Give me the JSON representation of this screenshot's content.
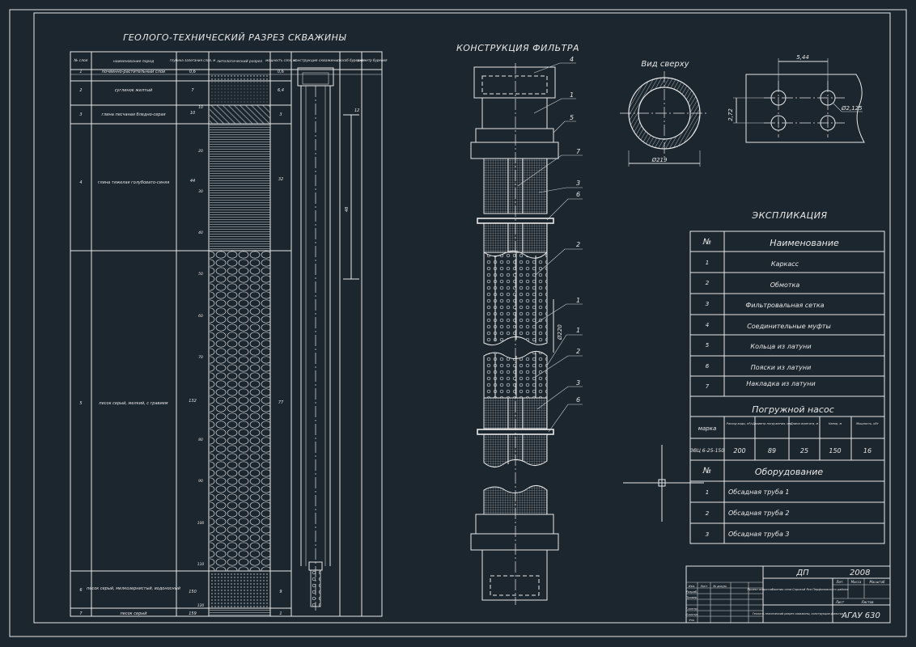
{
  "titles": {
    "section": "ГЕОЛОГО-ТЕХНИЧЕСКИЙ РАЗРЕЗ СКВАЖИНЫ",
    "filter": "КОНСТРУКЦИЯ ФИЛЬТРА",
    "top_view": "Вид сверху",
    "explication": "ЭКСПЛИКАЦИЯ"
  },
  "section_headers": [
    "№ слоя",
    "наименование пород",
    "глубина залегания слоя, м",
    "литологический разрез",
    "мощность слоя, м",
    "конструкция скважины",
    "способ бурения",
    "диаметр бурения"
  ],
  "section_layers": [
    {
      "no": "1",
      "name": "почвенно-растительный слой",
      "depth": "0,6",
      "thick": "0,6"
    },
    {
      "no": "2",
      "name": "суглинок желтый",
      "depth": "7",
      "thick": "6,4"
    },
    {
      "no": "3",
      "name": "глина песчаная бледно-серая",
      "depth": "10",
      "thick": "3"
    },
    {
      "no": "4",
      "name": "глина тяжелая голубовато-синяя",
      "depth": "44",
      "thick": "32"
    },
    {
      "no": "5",
      "name": "песок серый, мелкий, с гравием",
      "depth": "132",
      "thick": "77"
    },
    {
      "no": "6",
      "name": "песок серый, мелкозернистый, водоносный",
      "depth": "150",
      "thick": "9"
    },
    {
      "no": "7",
      "name": "песок серый",
      "depth": "159",
      "thick": "1"
    }
  ],
  "section_depth_ticks": [
    "10",
    "20",
    "30",
    "40",
    "50",
    "60",
    "70",
    "80",
    "90",
    "100",
    "110",
    "120"
  ],
  "section_right": {
    "top": "12",
    "mid": "48"
  },
  "filter_callouts": [
    "4",
    "1",
    "5",
    "7",
    "3",
    "6",
    "2",
    "1",
    "1",
    "2",
    "3",
    "6"
  ],
  "filter_dim": "Ø220",
  "top_view_dims": {
    "outer": "Ø219",
    "pitch_x": "5,44",
    "pitch_y": "2,72",
    "hole": "Ø2,125"
  },
  "explication": {
    "col_no": "№",
    "col_name": "Наименование",
    "rows": [
      {
        "no": "1",
        "name": "Каркасс"
      },
      {
        "no": "2",
        "name": "Обмотка"
      },
      {
        "no": "3",
        "name": "Фильтровальная сетка"
      },
      {
        "no": "4",
        "name": "Соединительные муфты"
      },
      {
        "no": "5",
        "name": "Кольца из латуни"
      },
      {
        "no": "6",
        "name": "Пояски из латуни"
      },
      {
        "no": "7",
        "name": "Накладка из латуни"
      }
    ]
  },
  "pump": {
    "title": "Погружной насос",
    "headers": [
      "марка",
      "Расход воды, м³/ч",
      "Диаметр погружения, мм",
      "Длина агрегата, м",
      "Напор, м",
      "Мощность, кВт"
    ],
    "row": [
      "ЭВЦ 6-25-150",
      "200",
      "89",
      "25",
      "150",
      "16"
    ]
  },
  "equipment": {
    "col_no": "№",
    "title": "Оборудование",
    "rows": [
      {
        "no": "1",
        "name": "Обсадная труба 1"
      },
      {
        "no": "2",
        "name": "Обсадная труба 2"
      },
      {
        "no": "3",
        "name": "Обсадная труба 3"
      }
    ]
  },
  "stamp": {
    "code": "ДП",
    "year": "2008",
    "project": "Проект водоснабжения села Сорокой Яса Перфиловского района",
    "sheet_title": "Геолого-технический разрез скважины, конструкция фильтра",
    "org": "АГАУ 630",
    "cols": [
      "Лит.",
      "Масса",
      "Масштаб"
    ],
    "labels": [
      "Лист",
      "Листов"
    ],
    "people": [
      "Изм.",
      "Лист",
      "№ докум.",
      "Разраб.",
      "Провер.",
      "Т.контр.",
      "Н.контр.",
      "Утв."
    ]
  }
}
